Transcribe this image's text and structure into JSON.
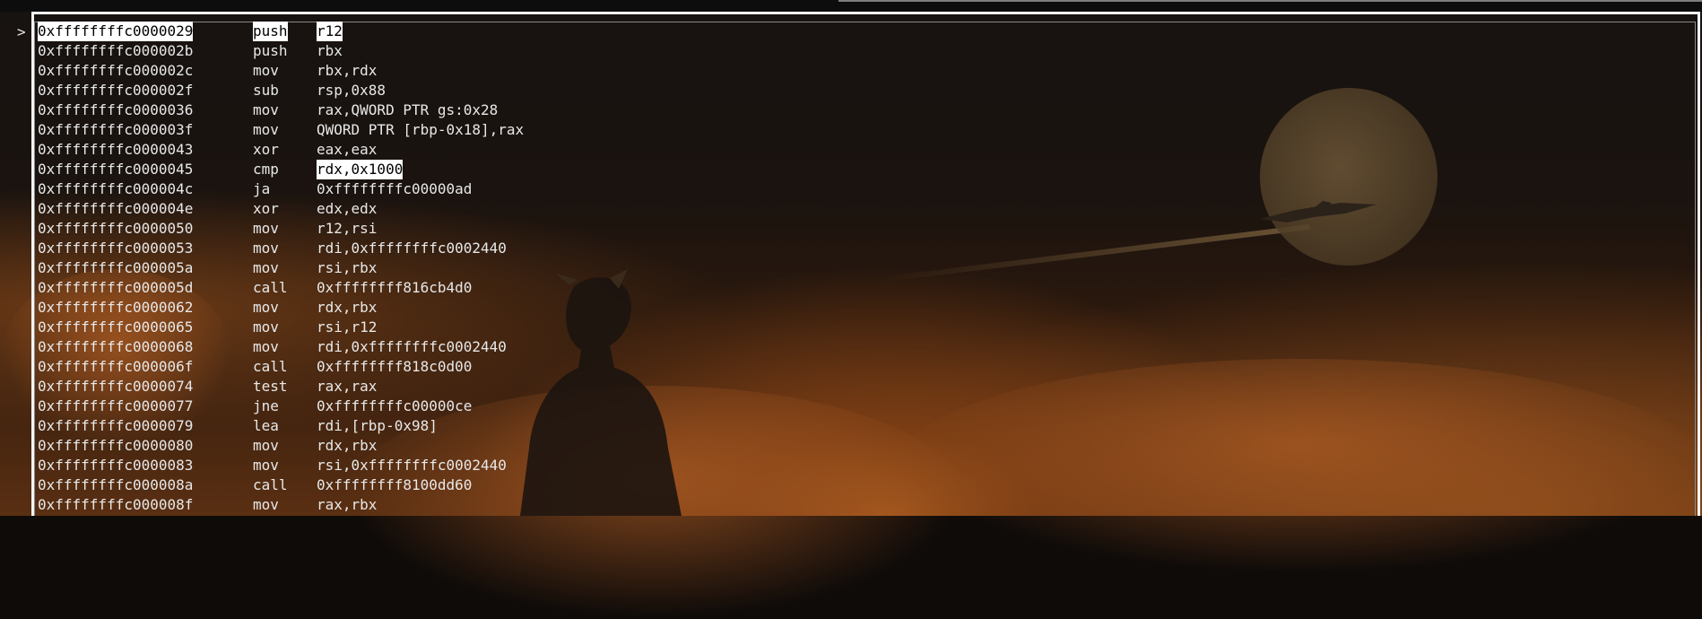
{
  "window": {
    "prompt_marker": ">"
  },
  "disassembly": {
    "rows": [
      {
        "address": "0xffffffffc0000029",
        "mnemonic": "push",
        "operands": "r12"
      },
      {
        "address": "0xffffffffc000002b",
        "mnemonic": "push",
        "operands": "rbx"
      },
      {
        "address": "0xffffffffc000002c",
        "mnemonic": "mov",
        "operands": "rbx,rdx"
      },
      {
        "address": "0xffffffffc000002f",
        "mnemonic": "sub",
        "operands": "rsp,0x88"
      },
      {
        "address": "0xffffffffc0000036",
        "mnemonic": "mov",
        "operands": "rax,QWORD PTR gs:0x28"
      },
      {
        "address": "0xffffffffc000003f",
        "mnemonic": "mov",
        "operands": "QWORD PTR [rbp-0x18],rax"
      },
      {
        "address": "0xffffffffc0000043",
        "mnemonic": "xor",
        "operands": "eax,eax"
      },
      {
        "address": "0xffffffffc0000045",
        "mnemonic": "cmp",
        "operands": "rdx,0x1000"
      },
      {
        "address": "0xffffffffc000004c",
        "mnemonic": "ja",
        "operands": "0xffffffffc00000ad"
      },
      {
        "address": "0xffffffffc000004e",
        "mnemonic": "xor",
        "operands": "edx,edx"
      },
      {
        "address": "0xffffffffc0000050",
        "mnemonic": "mov",
        "operands": "r12,rsi"
      },
      {
        "address": "0xffffffffc0000053",
        "mnemonic": "mov",
        "operands": "rdi,0xffffffffc0002440"
      },
      {
        "address": "0xffffffffc000005a",
        "mnemonic": "mov",
        "operands": "rsi,rbx"
      },
      {
        "address": "0xffffffffc000005d",
        "mnemonic": "call",
        "operands": "0xffffffff816cb4d0"
      },
      {
        "address": "0xffffffffc0000062",
        "mnemonic": "mov",
        "operands": "rdx,rbx"
      },
      {
        "address": "0xffffffffc0000065",
        "mnemonic": "mov",
        "operands": "rsi,r12"
      },
      {
        "address": "0xffffffffc0000068",
        "mnemonic": "mov",
        "operands": "rdi,0xffffffffc0002440"
      },
      {
        "address": "0xffffffffc000006f",
        "mnemonic": "call",
        "operands": "0xffffffff818c0d00"
      },
      {
        "address": "0xffffffffc0000074",
        "mnemonic": "test",
        "operands": "rax,rax"
      },
      {
        "address": "0xffffffffc0000077",
        "mnemonic": "jne",
        "operands": "0xffffffffc00000ce"
      },
      {
        "address": "0xffffffffc0000079",
        "mnemonic": "lea",
        "operands": "rdi,[rbp-0x98]"
      },
      {
        "address": "0xffffffffc0000080",
        "mnemonic": "mov",
        "operands": "rdx,rbx"
      },
      {
        "address": "0xffffffffc0000083",
        "mnemonic": "mov",
        "operands": "rsi,0xffffffffc0002440"
      },
      {
        "address": "0xffffffffc000008a",
        "mnemonic": "call",
        "operands": "0xffffffff8100dd60"
      },
      {
        "address": "0xffffffffc000008f",
        "mnemonic": "mov",
        "operands": "rax,rbx"
      }
    ]
  },
  "colors": {
    "text": "#e8e8e8",
    "highlight_bg": "#ffffff",
    "highlight_fg": "#000000",
    "frame": "#f4f4f4"
  }
}
